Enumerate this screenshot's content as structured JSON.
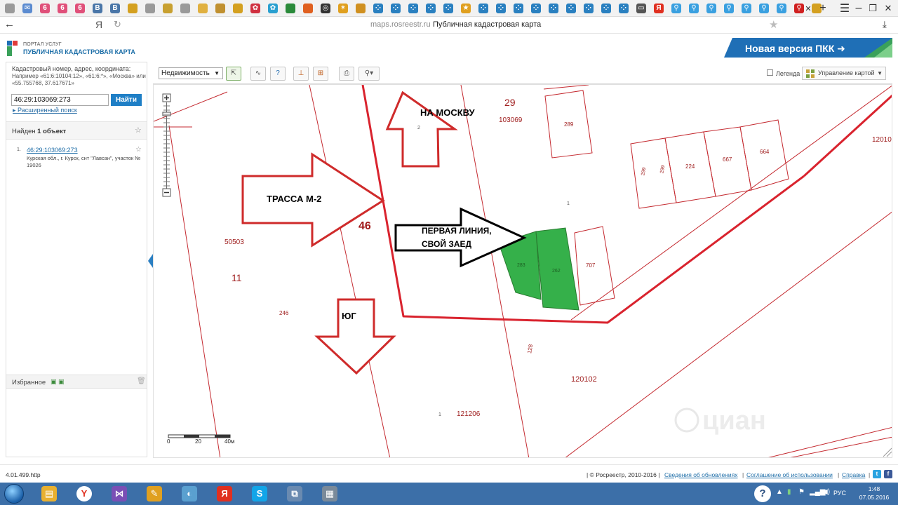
{
  "browser": {
    "tab_icons": [
      {
        "name": "page-icon",
        "color": "#9a9a9a",
        "glyph": ""
      },
      {
        "name": "mail-icon",
        "color": "#5b8bd0",
        "glyph": "✉"
      },
      {
        "name": "speedometer-icon",
        "color": "#e0507a",
        "glyph": "6"
      },
      {
        "name": "speedometer-icon",
        "color": "#e0507a",
        "glyph": "6"
      },
      {
        "name": "speedometer-icon",
        "color": "#e0507a",
        "glyph": "6"
      },
      {
        "name": "vk-icon",
        "color": "#4a76a8",
        "glyph": "B"
      },
      {
        "name": "vk-icon",
        "color": "#4a76a8",
        "glyph": "B"
      },
      {
        "name": "photo-icon",
        "color": "#d4a020",
        "glyph": ""
      },
      {
        "name": "page-icon",
        "color": "#9a9a9a",
        "glyph": ""
      },
      {
        "name": "globe-icon",
        "color": "#c8a030",
        "glyph": ""
      },
      {
        "name": "page-icon",
        "color": "#9a9a9a",
        "glyph": ""
      },
      {
        "name": "folder-icon",
        "color": "#e0b040",
        "glyph": ""
      },
      {
        "name": "compass-icon",
        "color": "#c09030",
        "glyph": ""
      },
      {
        "name": "photo-icon",
        "color": "#d4a020",
        "glyph": ""
      },
      {
        "name": "flower-icon",
        "color": "#d03040",
        "glyph": "✿"
      },
      {
        "name": "flower-icon",
        "color": "#2aa0d0",
        "glyph": "✿"
      },
      {
        "name": "globe-icon",
        "color": "#2a8a3a",
        "glyph": ""
      },
      {
        "name": "ok-icon",
        "color": "#e06020",
        "glyph": ""
      },
      {
        "name": "circle-icon",
        "color": "#333333",
        "glyph": "◎"
      },
      {
        "name": "star-icon",
        "color": "#e0a020",
        "glyph": "✶"
      },
      {
        "name": "globe-icon",
        "color": "#d09020",
        "glyph": ""
      },
      {
        "name": "dots-icon",
        "color": "#2a80c0",
        "glyph": "⁘"
      },
      {
        "name": "dots-icon",
        "color": "#2a80c0",
        "glyph": "⁘"
      },
      {
        "name": "dots-icon",
        "color": "#2a80c0",
        "glyph": "⁘"
      },
      {
        "name": "dots-icon",
        "color": "#2a80c0",
        "glyph": "⁘"
      },
      {
        "name": "dots-icon",
        "color": "#2a80c0",
        "glyph": "⁘"
      },
      {
        "name": "star-icon",
        "color": "#e0a020",
        "glyph": "★"
      },
      {
        "name": "dots-icon",
        "color": "#2a80c0",
        "glyph": "⁘"
      },
      {
        "name": "dots-icon",
        "color": "#2a80c0",
        "glyph": "⁘"
      },
      {
        "name": "dots-icon",
        "color": "#2a80c0",
        "glyph": "⁘"
      },
      {
        "name": "dots-icon",
        "color": "#2a80c0",
        "glyph": "⁘"
      },
      {
        "name": "dots-icon",
        "color": "#2a80c0",
        "glyph": "⁘"
      },
      {
        "name": "dots-icon",
        "color": "#2a80c0",
        "glyph": "⁘"
      },
      {
        "name": "dots-icon",
        "color": "#2a80c0",
        "glyph": "⁘"
      },
      {
        "name": "dots-icon",
        "color": "#2a80c0",
        "glyph": "⁘"
      },
      {
        "name": "dots-icon",
        "color": "#2a80c0",
        "glyph": "⁘"
      },
      {
        "name": "monitor-icon",
        "color": "#555555",
        "glyph": "▭"
      },
      {
        "name": "yandex-icon",
        "color": "#e03020",
        "glyph": "Я"
      },
      {
        "name": "map-pin-icon",
        "color": "#3aa0e0",
        "glyph": "⚲"
      },
      {
        "name": "map-pin-icon",
        "color": "#3aa0e0",
        "glyph": "⚲"
      },
      {
        "name": "map-pin-icon",
        "color": "#3aa0e0",
        "glyph": "⚲"
      },
      {
        "name": "map-pin-icon",
        "color": "#3aa0e0",
        "glyph": "⚲"
      },
      {
        "name": "map-pin-icon",
        "color": "#3aa0e0",
        "glyph": "⚲"
      },
      {
        "name": "map-pin-icon",
        "color": "#3aa0e0",
        "glyph": "⚲"
      },
      {
        "name": "map-pin-icon",
        "color": "#3aa0e0",
        "glyph": "⚲"
      },
      {
        "name": "map-pin-icon",
        "color": "#d02020",
        "glyph": "⚲"
      },
      {
        "name": "photo-icon",
        "color": "#d4a020",
        "glyph": ""
      }
    ],
    "active_tab_glyph": "✕",
    "new_tab_glyph": "+",
    "back_glyph": "←",
    "yandex_glyph": "Я",
    "reload_glyph": "↻",
    "url": "maps.rosreestr.ru",
    "page_title": "Публичная кадастровая карта",
    "bookmark_glyph": "★",
    "download_glyph": "⤓",
    "menu_glyph": "☰",
    "minimize_glyph": "–",
    "restore_glyph": "❐",
    "close_glyph": "✕"
  },
  "site": {
    "portal_label": "ПОРТАЛ УСЛУГ",
    "site_title": "ПУБЛИЧНАЯ КАДАСТРОВАЯ КАРТА",
    "new_version_label": "Новая версия ПКК ➜",
    "brand_blue": "#1f6fb6",
    "brand_green": "#3aa15a"
  },
  "left_panel": {
    "search_hint": "Кадастровый номер, адрес, координата:",
    "search_examples": "Например «61:6:10104:12», «61:6:*», «Москва» или «55.755768, 37.617671»",
    "search_value": "46:29:103069:273",
    "find_button": "Найти",
    "advanced_search": "Расширенный поиск",
    "found_prefix": "Найден ",
    "found_count": "1 объект",
    "results": [
      {
        "index": "1.",
        "cadastral_number": "46:29:103069:273",
        "address": "Курская обл., г. Курск, снт \"Лавсан\", участок № 19026"
      }
    ],
    "favorites_label": "Избранное"
  },
  "map_toolbar": {
    "layer_select": "Недвижимость",
    "legend_label": "Легенда",
    "map_control_label": "Управление картой"
  },
  "map": {
    "labels": {
      "quarter_29": "29",
      "block_103069": "103069",
      "parcel_289": "289",
      "label_2": "2",
      "label_1": "1",
      "parcel_299a": "299",
      "parcel_299b": "299",
      "parcel_224": "224",
      "parcel_667": "667",
      "parcel_664": "664",
      "block_12010": "12010",
      "label_46": "46",
      "block_50503": "50503",
      "label_11": "11",
      "label_246": "246",
      "parcel_707": "707",
      "parcel_green1": "283",
      "parcel_green2": "262",
      "label_128": "128",
      "block_120102": "120102",
      "block_121206": "121206",
      "label_1b": "1"
    },
    "annotations": {
      "moscow": "НА МОСКВУ",
      "highway": "ТРАССА М-2",
      "first_line_1": "ПЕРВАЯ ЛИНИЯ,",
      "first_line_2": "СВОЙ ЗАЕД",
      "south": "ЮГ"
    },
    "scale": {
      "zero": "0",
      "mid": "20",
      "max": "40м"
    },
    "watermark": "циан",
    "colors": {
      "boundary": "#d9232e",
      "parcel_line": "#c42a30",
      "highlight": "#35b04a",
      "arrow": "#cf2b2b"
    }
  },
  "footer": {
    "version": "4.01.499.http",
    "copyright": "| © Росреестр, 2010-2016 |",
    "link_updates": "Сведения об обновлениях",
    "link_terms": "Соглашение об использовании",
    "link_help": "Справка",
    "sep": "|"
  },
  "taskbar": {
    "apps": [
      {
        "name": "explorer-icon",
        "color": "#e8b030",
        "glyph": "▤"
      },
      {
        "name": "yandex-browser-icon",
        "color": "#ffffff",
        "glyph": "Y"
      },
      {
        "name": "visual-studio-icon",
        "color": "#7a4fb5",
        "glyph": "⋈"
      },
      {
        "name": "pencil-icon",
        "color": "#e0a020",
        "glyph": "✎"
      },
      {
        "name": "paint-icon",
        "color": "#5aa0d0",
        "glyph": "◐"
      },
      {
        "name": "yandex-icon",
        "color": "#e03020",
        "glyph": "Я"
      },
      {
        "name": "skype-icon",
        "color": "#12a5e8",
        "glyph": "S"
      },
      {
        "name": "remote-desktop-icon",
        "color": "#6a8ab0",
        "glyph": "⧉"
      },
      {
        "name": "calculator-icon",
        "color": "#7a8a9a",
        "glyph": "▦"
      }
    ],
    "help_glyph": "?",
    "language": "РУС",
    "time": "1:48",
    "date": "07.05.2016"
  }
}
